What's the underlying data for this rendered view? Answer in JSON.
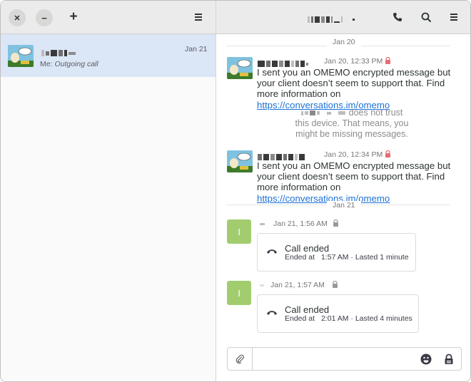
{
  "left_header": {
    "close_glyph": "✕",
    "minimize_glyph": "−",
    "add_glyph": "+",
    "menu_glyph": "☰"
  },
  "conversation_list": [
    {
      "date": "Jan 21",
      "preview_prefix": "Me:",
      "preview_text": "Outgoing call"
    }
  ],
  "right_header": {
    "icons": [
      "phone-icon",
      "search-icon",
      "menu-icon"
    ]
  },
  "messages": {
    "date_sep_1": "Jan 20",
    "msg1": {
      "time": "Jan 20, 12:33 PM",
      "text_before_link": "I sent you an OMEMO encrypted message but your client doesn’t seem to support that. Find more information on",
      "link": "https://conversations.im/omemo"
    },
    "note": {
      "line1": "does not trust",
      "line2": "this device. That means, you",
      "line3": "might be missing messages."
    },
    "msg2": {
      "time": "Jan 20, 12:34 PM",
      "text_before_link": "I sent you an OMEMO encrypted message but your client doesn’t seem to support that. Find more information on",
      "link": "https://conversations.im/omemo"
    },
    "date_sep_2": "Jan 21",
    "call1": {
      "avatar_letter": "I",
      "time": "Jan 21,  1:56 AM",
      "title": "Call ended",
      "ended_at_label": "Ended at",
      "ended_at": "1:57 AM",
      "duration": "· Lasted 1 minute"
    },
    "call2": {
      "avatar_letter": "I",
      "time": "Jan 21,  1:57 AM",
      "title": "Call ended",
      "ended_at_label": "Ended at",
      "ended_at": "2:01 AM",
      "duration": "· Lasted 4 minutes"
    }
  },
  "input": {
    "placeholder": ""
  },
  "colors": {
    "selection": "#dbe6f6",
    "link": "#1c71d8",
    "lock_red": "#e01b24",
    "avatar_green": "#a1cd6f"
  }
}
